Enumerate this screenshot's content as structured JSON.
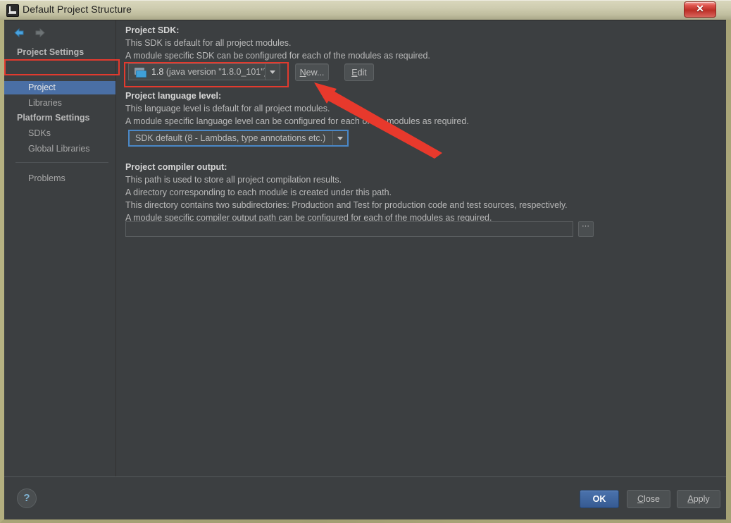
{
  "window": {
    "title": "Default Project Structure",
    "title_icon": "intellij-idea-icon",
    "close_label": "✕"
  },
  "sidebar": {
    "nav": {
      "back_icon": "arrow-left-icon",
      "forward_icon": "arrow-right-icon"
    },
    "sections": [
      {
        "header": "Project Settings",
        "items": [
          {
            "label": "Project",
            "selected": true
          },
          {
            "label": "Libraries",
            "selected": false
          }
        ]
      },
      {
        "header": "Platform Settings",
        "items": [
          {
            "label": "SDKs",
            "selected": false
          },
          {
            "label": "Global Libraries",
            "selected": false
          }
        ]
      }
    ],
    "problems_label": "Problems"
  },
  "content": {
    "sdk_section": {
      "title": "Project SDK:",
      "desc1": "This SDK is default for all project modules.",
      "desc2": "A module specific SDK can be configured for each of the modules as required.",
      "combo_icon": "sdk-folder-icon",
      "combo_value_name": "1.8",
      "combo_value_detail": "(java version \"1.8.0_101\")",
      "new_button": "New...",
      "new_button_mnemonic": "N",
      "edit_button": "Edit",
      "edit_button_mnemonic": "E"
    },
    "language_section": {
      "title": "Project language level:",
      "desc1": "This language level is default for all project modules.",
      "desc2": "A module specific language level can be configured for each of the modules as required.",
      "combo_value": "SDK default (8 - Lambdas, type annotations etc.)"
    },
    "compiler_section": {
      "title": "Project compiler output:",
      "desc1": "This path is used to store all project compilation results.",
      "desc2": "A directory corresponding to each module is created under this path.",
      "desc3": "This directory contains two subdirectories: Production and Test for production code and test sources, respectively.",
      "desc4": "A module specific compiler output path can be configured for each of the modules as required.",
      "path_value": "",
      "path_placeholder": "",
      "browse_label": "⋯"
    }
  },
  "footer": {
    "help_label": "?",
    "ok_label": "OK",
    "close_label": "Close",
    "close_mnemonic": "C",
    "apply_label": "Apply",
    "apply_mnemonic": "A"
  },
  "annotations": {
    "accent_color": "#e23a2e",
    "highlight_sidebar_item": "Project",
    "highlight_control": "Project SDK combo box",
    "arrow_points_to": "New... button"
  },
  "theme": {
    "panel_bg": "#3c3f41",
    "selection_blue": "#4a6fa5",
    "focus_blue": "#4a88c7",
    "text_primary": "#d6d6d6",
    "text_secondary": "#b9b9b9",
    "titlebar_text": "#1d1d1d"
  }
}
